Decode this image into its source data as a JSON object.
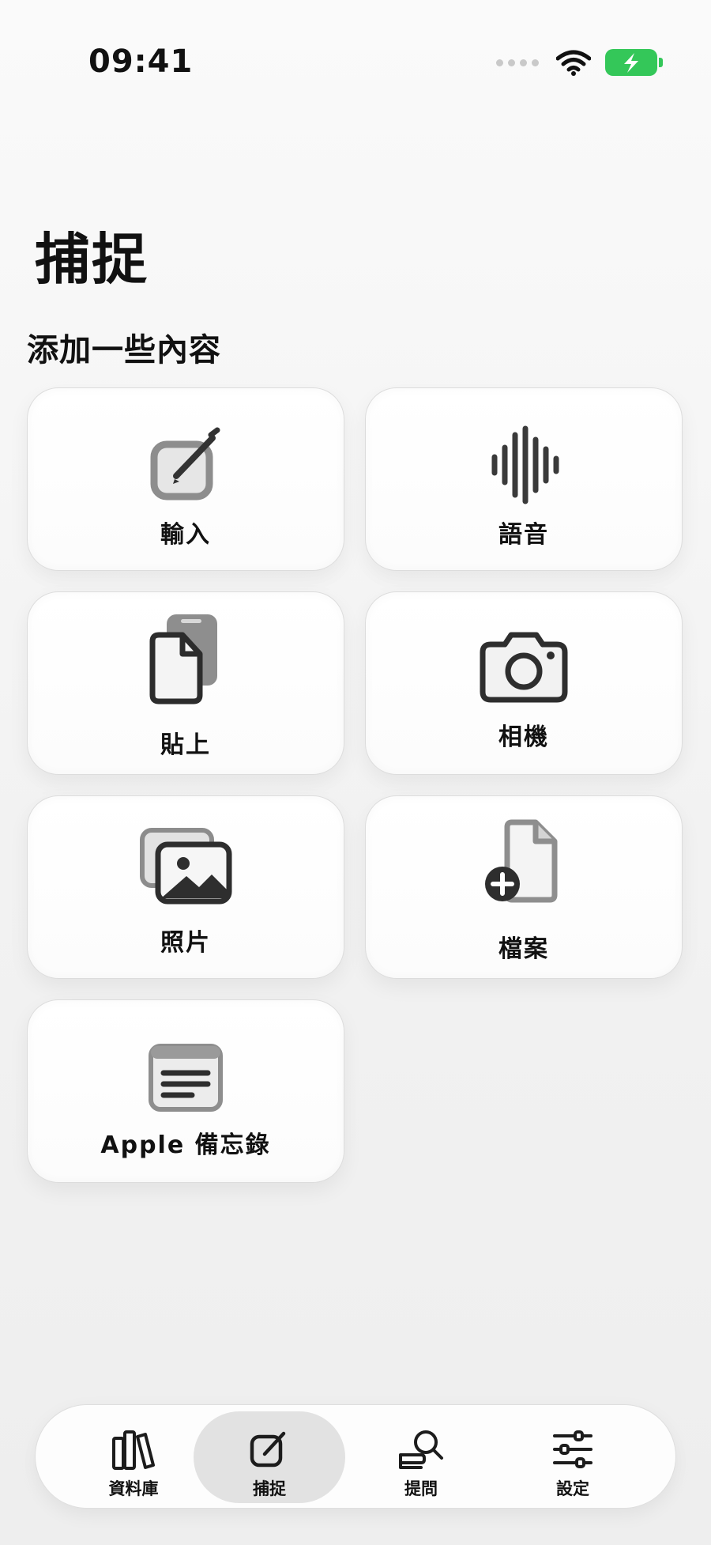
{
  "status_bar": {
    "time": "09:41"
  },
  "header": {
    "title": "捕捉"
  },
  "section": {
    "title": "添加一些內容"
  },
  "cards": [
    {
      "label": "輸入",
      "icon": "compose-icon"
    },
    {
      "label": "語音",
      "icon": "waveform-icon"
    },
    {
      "label": "貼上",
      "icon": "paste-icon"
    },
    {
      "label": "相機",
      "icon": "camera-icon"
    },
    {
      "label": "照片",
      "icon": "photos-icon"
    },
    {
      "label": "檔案",
      "icon": "add-file-icon"
    },
    {
      "label": "Apple 備忘錄",
      "icon": "notes-icon"
    }
  ],
  "tab_bar": {
    "items": [
      {
        "label": "資料庫",
        "icon": "books-icon",
        "active": false
      },
      {
        "label": "捕捉",
        "icon": "compose-icon",
        "active": true
      },
      {
        "label": "提問",
        "icon": "ask-icon",
        "active": false
      },
      {
        "label": "設定",
        "icon": "sliders-icon",
        "active": false
      }
    ]
  },
  "colors": {
    "battery": "#34c759",
    "active_tab": "#e2e2e2",
    "background": "#f2f2f2"
  }
}
